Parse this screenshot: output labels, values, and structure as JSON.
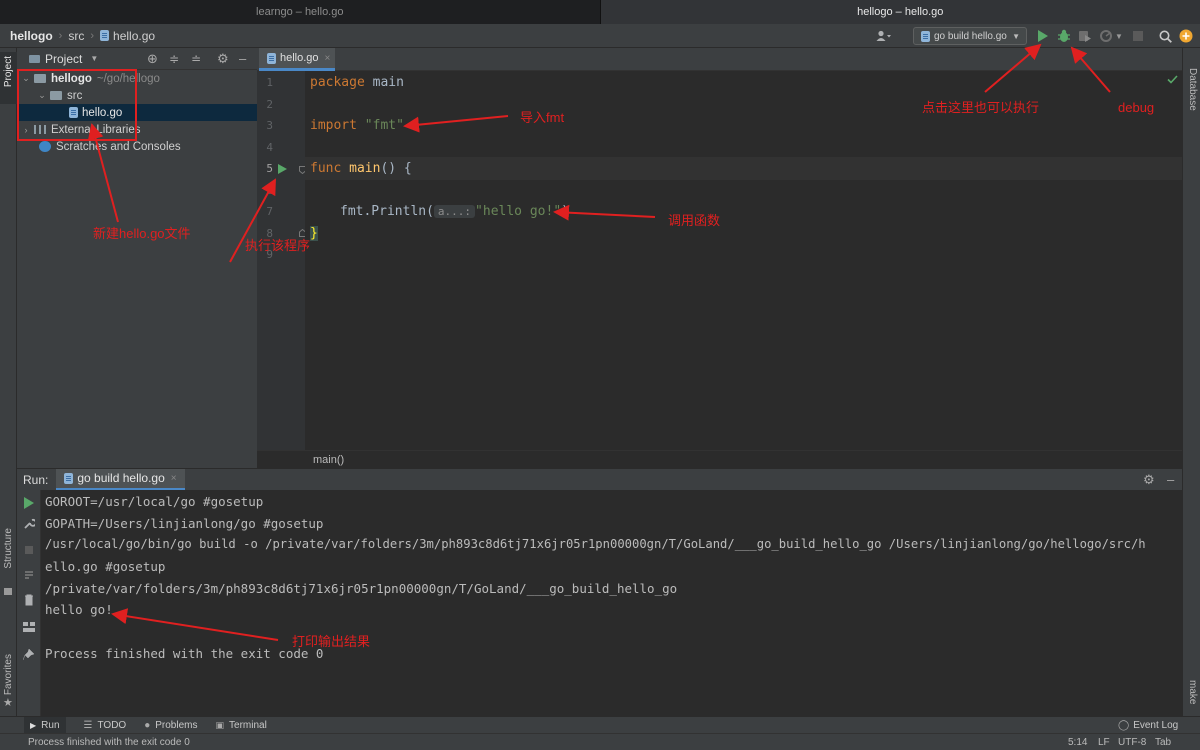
{
  "window_tabs": [
    "learngo – hello.go",
    "hellogo – hello.go"
  ],
  "navbar": {
    "project": "hellogo",
    "folder": "src",
    "file": "hello.go"
  },
  "toolbar": {
    "run_config": "go build hello.go"
  },
  "left_strip": {
    "project": "Project",
    "structure": "Structure",
    "favorites": "Favorites"
  },
  "right_strip": {
    "database": "Database",
    "make": "make"
  },
  "project_panel": {
    "title": "Project",
    "tree": {
      "root": "hellogo",
      "root_path": "~/go/hellogo",
      "src": "src",
      "file": "hello.go",
      "ext_libs": "External Libraries",
      "scratches": "Scratches and Consoles"
    }
  },
  "editor": {
    "tab": "hello.go",
    "line_numbers": [
      "1",
      "2",
      "3",
      "4",
      "5",
      "6",
      "7",
      "8",
      "9"
    ],
    "code": {
      "l1_kw": "package",
      "l1_rest": " main",
      "l3_kw": "import",
      "l3_str": "\"fmt\"",
      "l5_kw": "func",
      "l5_fn": " main",
      "l5_rest": "() {",
      "l7_pre": "fmt.Println(",
      "l7_hint": "a...:",
      "l7_str": "\"hello go!\"",
      "l7_post": ")",
      "l8": "}"
    },
    "breadcrumb": "main()"
  },
  "run_panel": {
    "label": "Run:",
    "tab": "go build hello.go",
    "lines": [
      "GOROOT=/usr/local/go #gosetup",
      "GOPATH=/Users/linjianlong/go #gosetup",
      "/usr/local/go/bin/go build -o /private/var/folders/3m/ph893c8d6tj71x6jr05r1pn00000gn/T/GoLand/___go_build_hello_go /Users/linjianlong/go/hellogo/src/h",
      "ello.go #gosetup",
      "/private/var/folders/3m/ph893c8d6tj71x6jr05r1pn00000gn/T/GoLand/___go_build_hello_go",
      "hello go!",
      "",
      "Process finished with the exit code 0"
    ]
  },
  "bottom_tabs": {
    "run": "Run",
    "todo": "TODO",
    "problems": "Problems",
    "terminal": "Terminal",
    "event_log": "Event Log"
  },
  "status": {
    "message": "Process finished with the exit code 0",
    "position": "5:14",
    "line_sep": "LF",
    "encoding": "UTF-8",
    "indent": "Tab"
  },
  "annotations": {
    "new_file": "新建hello.go文件",
    "run_program": "执行该程序",
    "import_fmt": "导入fmt",
    "call_func": "调用函数",
    "click_run": "点击这里也可以执行",
    "debug": "debug",
    "print_result": "打印输出结果"
  },
  "colors": {
    "annotation": "#e02020",
    "run_green": "#59a869",
    "accent": "#4a88c7"
  }
}
